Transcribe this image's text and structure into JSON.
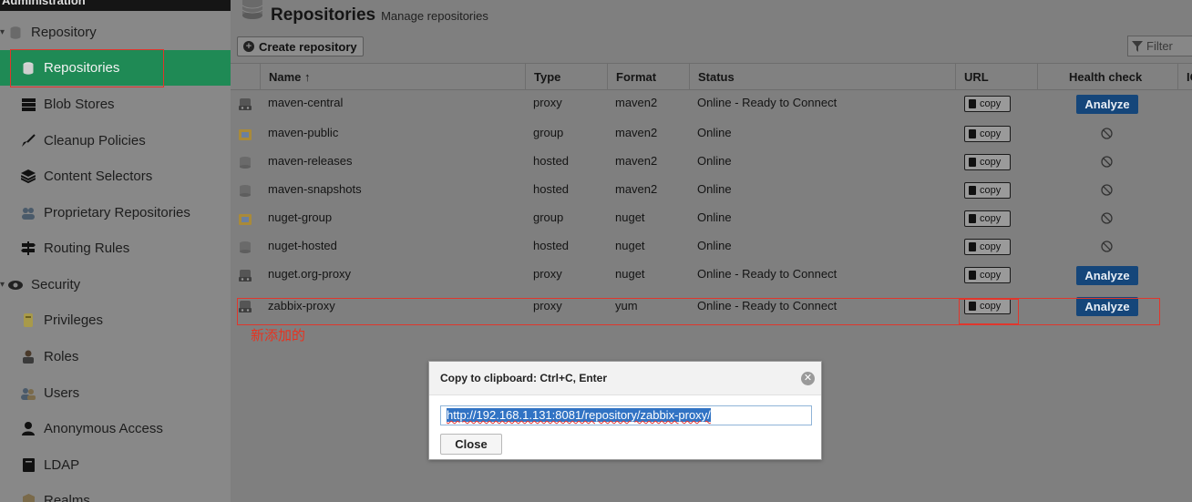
{
  "sidebar": {
    "header": "Administration",
    "groups": [
      {
        "label": "Repository",
        "icon": "database-icon"
      },
      {
        "label": "Security",
        "icon": "eye-icon"
      }
    ],
    "items": [
      {
        "label": "Repositories",
        "icon": "database-icon"
      },
      {
        "label": "Blob Stores",
        "icon": "server-icon"
      },
      {
        "label": "Cleanup Policies",
        "icon": "broom-icon"
      },
      {
        "label": "Content Selectors",
        "icon": "layers-icon"
      },
      {
        "label": "Proprietary Repositories",
        "icon": "users-icon"
      },
      {
        "label": "Routing Rules",
        "icon": "signpost-icon"
      },
      {
        "label": "Privileges",
        "icon": "medal-icon"
      },
      {
        "label": "Roles",
        "icon": "user-badge-icon"
      },
      {
        "label": "Users",
        "icon": "users-icon"
      },
      {
        "label": "Anonymous Access",
        "icon": "user-icon"
      },
      {
        "label": "LDAP",
        "icon": "book-icon"
      },
      {
        "label": "Realms",
        "icon": "shield-icon"
      }
    ]
  },
  "header": {
    "title": "Repositories",
    "subtitle": "Manage repositories"
  },
  "toolbar": {
    "create_label": "Create repository",
    "filter_placeholder": "Filter"
  },
  "table": {
    "columns": [
      "Name ↑",
      "Type",
      "Format",
      "Status",
      "URL",
      "Health check",
      "IQ"
    ],
    "rows": [
      {
        "name": "maven-central",
        "type": "proxy",
        "format": "maven2",
        "status": "Online - Ready to Connect",
        "health": "Analyze"
      },
      {
        "name": "maven-public",
        "type": "group",
        "format": "maven2",
        "status": "Online",
        "health": ""
      },
      {
        "name": "maven-releases",
        "type": "hosted",
        "format": "maven2",
        "status": "Online",
        "health": ""
      },
      {
        "name": "maven-snapshots",
        "type": "hosted",
        "format": "maven2",
        "status": "Online",
        "health": ""
      },
      {
        "name": "nuget-group",
        "type": "group",
        "format": "nuget",
        "status": "Online",
        "health": ""
      },
      {
        "name": "nuget-hosted",
        "type": "hosted",
        "format": "nuget",
        "status": "Online",
        "health": ""
      },
      {
        "name": "nuget.org-proxy",
        "type": "proxy",
        "format": "nuget",
        "status": "Online - Ready to Connect",
        "health": "Analyze"
      },
      {
        "name": "zabbix-proxy",
        "type": "proxy",
        "format": "yum",
        "status": "Online - Ready to Connect",
        "health": "Analyze"
      }
    ],
    "copy_label": "copy"
  },
  "annotation": "新添加的",
  "dialog": {
    "title": "Copy to clipboard: Ctrl+C, Enter",
    "url": "http://192.168.1.131:8081/repository/zabbix-proxy/",
    "close_label": "Close"
  },
  "colors": {
    "accent": "#1f8a55",
    "analyze": "#15467a",
    "annotation": "#e0362c"
  }
}
